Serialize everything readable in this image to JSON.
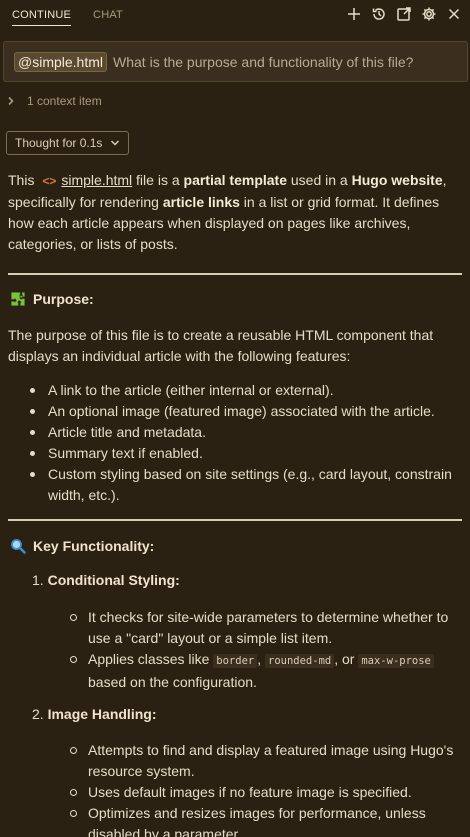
{
  "tabs": [
    {
      "label": "CONTINUE"
    },
    {
      "label": "CHAT"
    }
  ],
  "toolbar_icons": [
    "plus-icon",
    "history-icon",
    "open-external-icon",
    "settings-icon",
    "close-icon"
  ],
  "prompt": {
    "mention": "@simple.html",
    "text": "What is the purpose and functionality of this file?"
  },
  "context": {
    "label": "1 context item"
  },
  "thought": {
    "label": "Thought for 0.1s"
  },
  "intro": {
    "t1": "This ",
    "file": "simple.html",
    "t2": " file is a ",
    "b1": "partial template",
    "t3": " used in a ",
    "b2": "Hugo website",
    "t4": ", specifically for rendering ",
    "b3": "article links",
    "t5": " in a list or grid format. It defines how each article appears when displayed on pages like archives, categories, or lists of posts."
  },
  "purpose": {
    "heading": "Purpose:",
    "text": "The purpose of this file is to create a reusable HTML component that displays an individual article with the following features:",
    "bullets": [
      "A link to the article (either internal or external).",
      "An optional image (featured image) associated with the article.",
      "Article title and metadata.",
      "Summary text if enabled.",
      "Custom styling based on site settings (e.g., card layout, constrain width, etc.)."
    ]
  },
  "functionality": {
    "heading": "Key Functionality:",
    "items": [
      {
        "number": "1.",
        "title": "Conditional Styling:",
        "sub": {
          "s1": "It checks for site-wide parameters to determine whether to use a \"card\" layout or a simple list item.",
          "s2a": "Applies classes like ",
          "c1": "border",
          "s2b": ", ",
          "c2": "rounded-md",
          "s2c": ", or ",
          "c3": "max-w-prose",
          "s2d": " based on the configuration."
        }
      },
      {
        "number": "2.",
        "title": "Image Handling:",
        "sub": {
          "s1": "Attempts to find and display a featured image using Hugo's resource system.",
          "s2": "Uses default images if no feature image is specified.",
          "s3": "Optimizes and resizes images for performance, unless disabled by a parameter."
        }
      }
    ]
  },
  "colors": {
    "background": "#2b2112",
    "text": "#e6dcc8",
    "accent_file_icon": "#d97a3a"
  }
}
